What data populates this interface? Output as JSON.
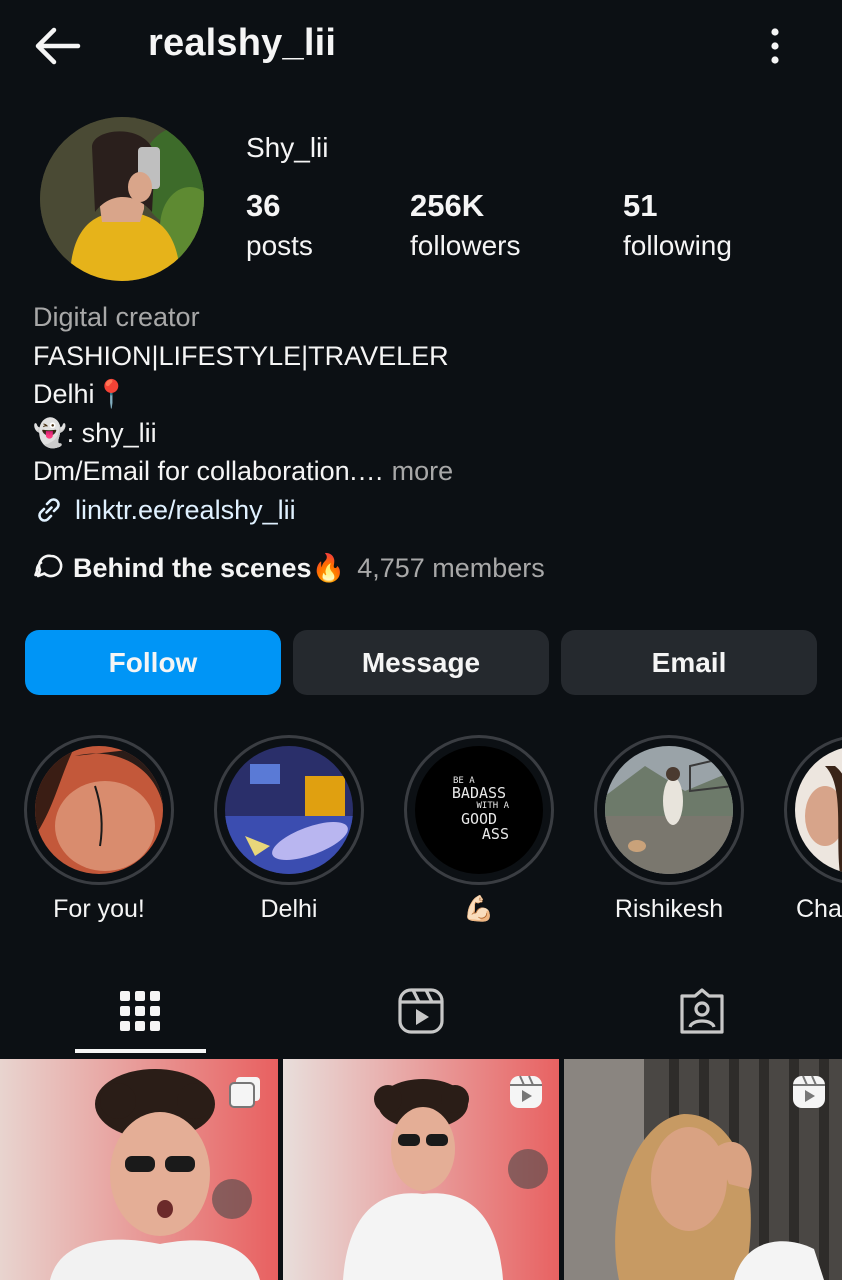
{
  "header": {
    "username": "realshy_lii",
    "back_icon": "arrow-left-icon",
    "menu_icon": "more-vertical-icon"
  },
  "profile": {
    "display_name": "Shy_lii",
    "stats": [
      {
        "value": "36",
        "label": "posts"
      },
      {
        "value": "256K",
        "label": "followers"
      },
      {
        "value": "51",
        "label": "following"
      }
    ]
  },
  "bio": {
    "category": "Digital creator",
    "line1": "FASHION|LIFESTYLE|TRAVELER",
    "line2": "Delhi📍",
    "line3": "👻: shy_lii",
    "line4": "Dm/Email for collaboration.…",
    "more": "more",
    "link": "linktr.ee/realshy_lii"
  },
  "channel": {
    "name": "Behind the scenes🔥",
    "members": "4,757 members"
  },
  "actions": {
    "follow": "Follow",
    "message": "Message",
    "email": "Email"
  },
  "highlights": [
    {
      "label": "For you!"
    },
    {
      "label": "Delhi"
    },
    {
      "label": "💪🏻",
      "cover_text": [
        "BE A",
        "BADASS",
        "WITH A",
        "GOOD",
        "ASS"
      ]
    },
    {
      "label": "Rishikesh"
    },
    {
      "label": "Char"
    }
  ],
  "tabs": [
    "grid-icon",
    "reels-icon",
    "tagged-icon"
  ],
  "colors": {
    "background": "#0c1014",
    "follow_button": "#0095f6",
    "secondary_button": "#25292e",
    "link": "#e0f1ff"
  }
}
